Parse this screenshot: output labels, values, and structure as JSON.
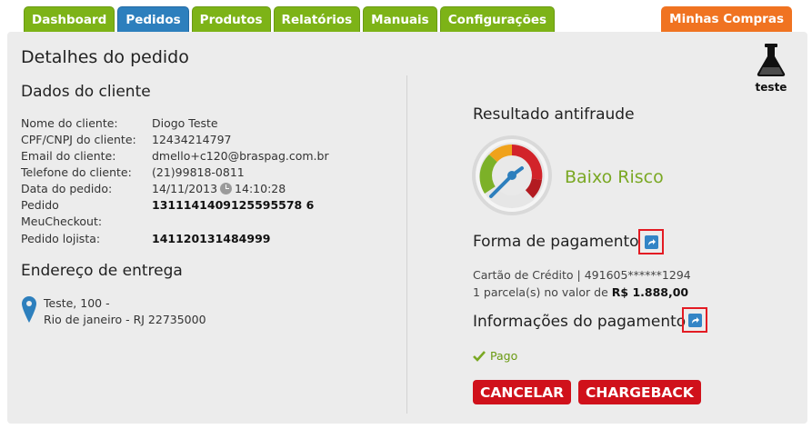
{
  "nav": {
    "tabs": [
      "Dashboard",
      "Pedidos",
      "Produtos",
      "Relatórios",
      "Manuais",
      "Configurações"
    ],
    "active": "Pedidos",
    "right_tab": "Minhas Compras"
  },
  "env_badge": {
    "label": "teste",
    "icon": "flask-icon"
  },
  "page_title": "Detalhes do pedido",
  "cliente": {
    "title": "Dados do cliente",
    "fields": [
      {
        "label": "Nome do cliente:",
        "value": "Diogo Teste"
      },
      {
        "label": "CPF/CNPJ do cliente:",
        "value": "12434214797"
      },
      {
        "label": "Email do cliente:",
        "value": "dmello+c120@braspag.com.br"
      },
      {
        "label": "Telefone do cliente:",
        "value": "(21)99818-0811"
      },
      {
        "label": "Data do pedido:",
        "value_date": "14/11/2013",
        "value_time": "14:10:28"
      },
      {
        "label": "Pedido",
        "value": "1311141409125595578 6"
      },
      {
        "label": "MeuCheckout:",
        "value": ""
      },
      {
        "label": "Pedido lojista:",
        "value": "141120131484999"
      }
    ]
  },
  "endereco": {
    "title": "Endereço de entrega",
    "line1": "Teste, 100 -",
    "line2": "Rio de janeiro - RJ 22735000"
  },
  "antifraude": {
    "title": "Resultado antifraude",
    "result": "Baixo Risco",
    "result_color": "#7aa823"
  },
  "pagamento": {
    "title": "Forma de pagamento",
    "card_line": "Cartão de Crédito | 491605******1294",
    "installments_prefix": "1 parcela(s) no valor de",
    "installments_amount": "R$ 1.888,00"
  },
  "info_pagamento": {
    "title": "Informações do pagamento",
    "status": "Pago"
  },
  "actions": {
    "cancel": "CANCELAR",
    "chargeback": "CHARGEBACK"
  },
  "colors": {
    "tab_green": "#7db317",
    "tab_blue": "#2d7fbd",
    "tab_orange": "#f07321",
    "button_red": "#d0111b",
    "highlight_red": "#e31b23"
  }
}
